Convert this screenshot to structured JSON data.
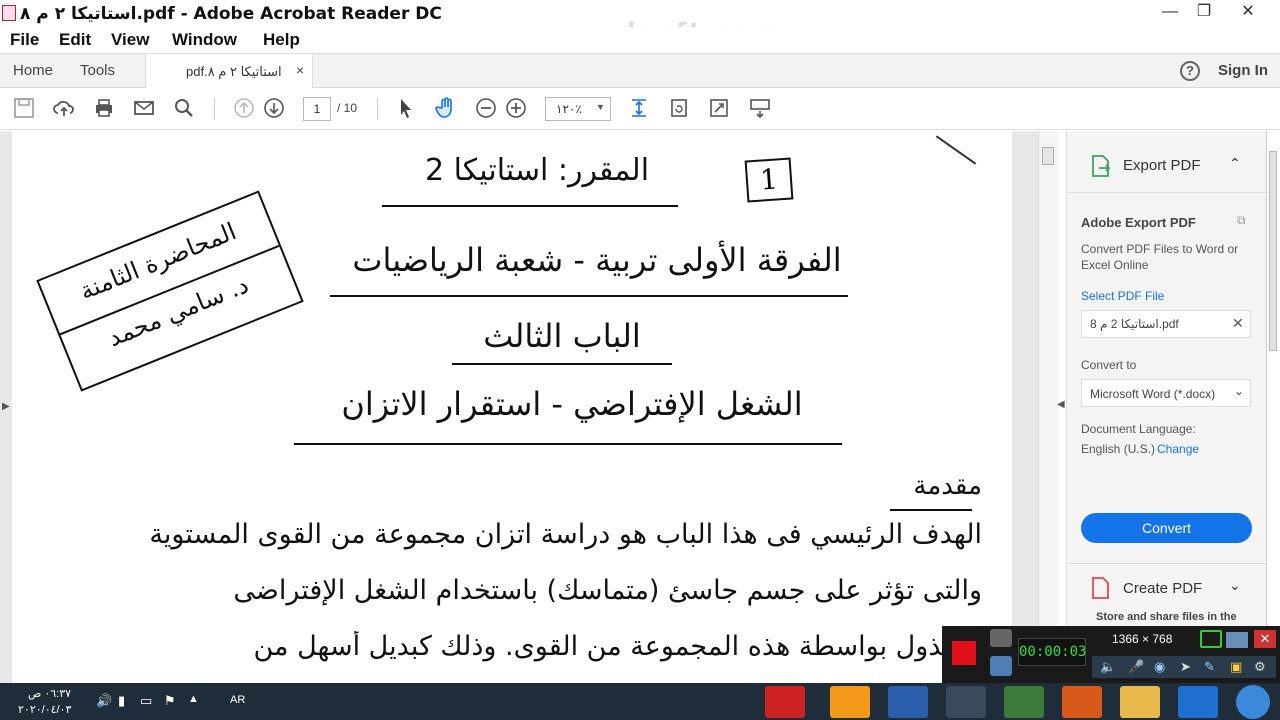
{
  "window": {
    "title": "استاتيكا ٢ م ٨.pdf - Adobe Acrobat Reader DC",
    "watermark": "www.zdsoft.com"
  },
  "menu": [
    "File",
    "Edit",
    "View",
    "Window",
    "Help"
  ],
  "tabs": {
    "home": "Home",
    "tools": "Tools",
    "doc_tab": "استاتيكا ٢ م ٨.pdf",
    "help": "?",
    "sign_in": "Sign In"
  },
  "toolbar": {
    "page_current": "1",
    "page_total": "/ 10",
    "zoom": "١٢٠٪"
  },
  "document": {
    "page_number": "1",
    "course": "المقرر: استاتيكا 2",
    "lecture_box_line1": "المحاضرة الثامنة",
    "lecture_box_line2": "د. سامي محمد",
    "grade": "الفرقة الأولى تربية - شعبة الرياضيات",
    "chapter": "الباب الثالث",
    "topic": "الشغل الإفتراضي - استقرار الاتزان",
    "intro": "مقدمة",
    "body_line1": "الهدف الرئيسي فى هذا الباب هو دراسة اتزان مجموعة من القوى المستوية",
    "body_line2": "والتى تؤثر على جسم جاسئ (متماسك) باستخدام الشغل الإفتراضى",
    "body_line3": "المبذول بواسطة هذه المجموعة من القوى. وذلك كبديل أسهل من"
  },
  "right_pane": {
    "export_title": "Export PDF",
    "adobe_export": "Adobe Export PDF",
    "desc": "Convert PDF Files to Word or Excel Online",
    "select_file": "Select PDF File",
    "file_name": "استاتيكا 2 م 8.pdf",
    "convert_to": "Convert to",
    "format": "Microsoft Word (*.docx)",
    "doc_language": "Document Language:",
    "language": "English (U.S.)",
    "change": "Change",
    "convert_btn": "Convert",
    "create_pdf": "Create PDF",
    "store_share": "Store and share files in the"
  },
  "recorder": {
    "resolution": "1366 × 768",
    "timer": "00:00:03"
  },
  "taskbar": {
    "time": "٠٦:٣٧ ص",
    "date": "٢٠٢٠/٠٤/٠٣",
    "lang": "AR"
  },
  "colors": {
    "accent_blue": "#1473e6",
    "tab_bg": "#f2f2f2",
    "taskbar": "#1f2d3a"
  }
}
